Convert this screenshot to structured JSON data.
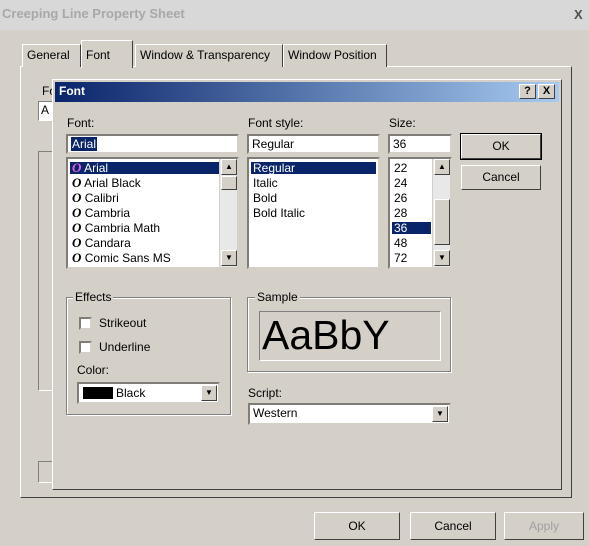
{
  "outer": {
    "title": "Creeping Line Property Sheet",
    "close": "X",
    "tabs": [
      "General",
      "Font",
      "Window & Transparency",
      "Window Position"
    ],
    "behind_label": "Fo",
    "behind_field": "A",
    "buttons": {
      "ok": "OK",
      "cancel": "Cancel",
      "apply": "Apply"
    }
  },
  "dialog": {
    "title": "Font",
    "help": "?",
    "close": "X",
    "font_label": "Font:",
    "font_value": "Arial",
    "font_items": [
      "Arial",
      "Arial Black",
      "Calibri",
      "Cambria",
      "Cambria Math",
      "Candara",
      "Comic Sans MS"
    ],
    "style_label": "Font style:",
    "style_value": "Regular",
    "style_items": [
      "Regular",
      "Italic",
      "Bold",
      "Bold Italic"
    ],
    "size_label": "Size:",
    "size_value": "36",
    "size_items": [
      "22",
      "24",
      "26",
      "28",
      "36",
      "48",
      "72"
    ],
    "ok": "OK",
    "cancel": "Cancel",
    "effects_label": "Effects",
    "strikeout": "Strikeout",
    "underline": "Underline",
    "color_label": "Color:",
    "color_value": "Black",
    "color_swatch": "#000000",
    "sample_label": "Sample",
    "sample_text": "AaBbY",
    "script_label": "Script:",
    "script_value": "Western"
  },
  "colors": {
    "selection": "#0a246a",
    "title_start": "#0a246a",
    "title_end": "#a6caf0",
    "face": "#d4d0c8"
  }
}
